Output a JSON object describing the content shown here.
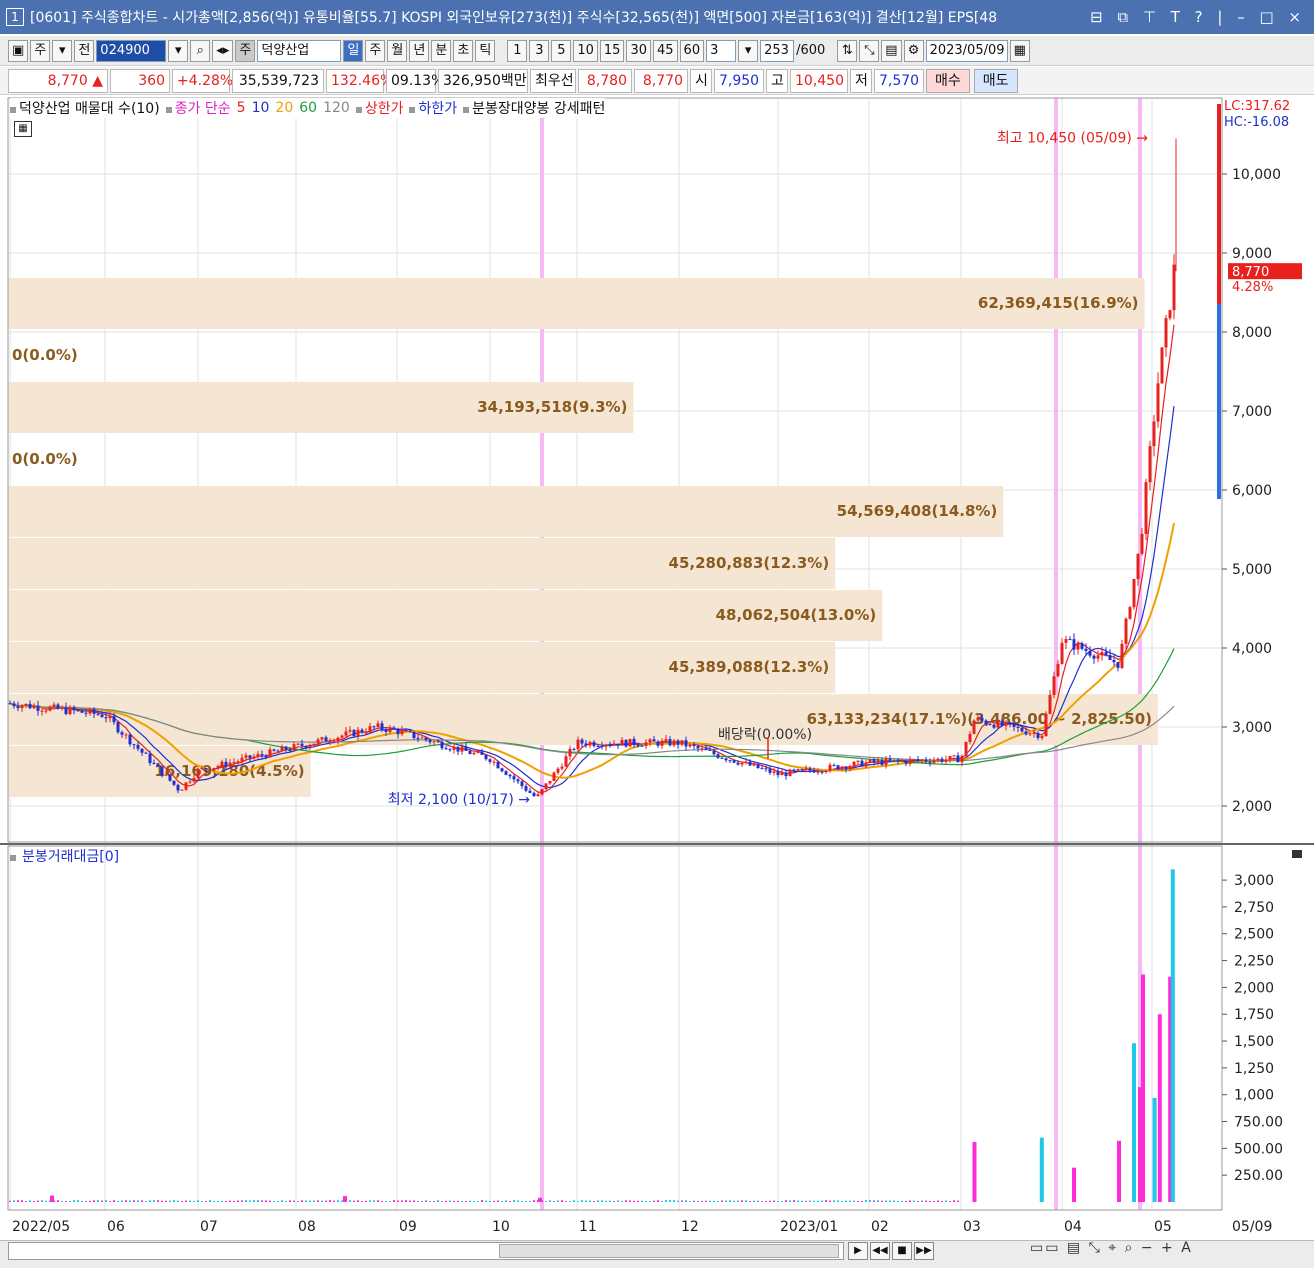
{
  "window": {
    "number": "1",
    "title": "[0601] 주식종합차트 - 시가총액[2,856(억)] 유통비율[55.7] KOSPI 외국인보유[273(천)] 주식수[32,565(천)] 액면[500] 자본금[163(억)] 결산[12월] EPS[48",
    "controls": "⊟ ⧉ ⊤ T ? | – □ ×"
  },
  "toolbar": {
    "market": "주",
    "all": "전",
    "code": "024900",
    "stock_badge": "주",
    "stock_name": "덕양산업",
    "periods": [
      "일",
      "주",
      "월",
      "년",
      "분",
      "초",
      "틱"
    ],
    "selected_period": "일",
    "intervals": [
      "1",
      "3",
      "5",
      "10",
      "15",
      "30",
      "45",
      "60"
    ],
    "interval_value": "3",
    "count": "253",
    "count_total": "/600",
    "date": "2023/05/09"
  },
  "quote": {
    "price": "8,770",
    "arrow": "▲",
    "change": "360",
    "change_pct": "+4.28%",
    "volume": "35,539,723",
    "vol_ratio": "132.46%",
    "turnover": "09.13%",
    "amount": "326,950백만",
    "best_label": "최우선",
    "best_ask": "8,780",
    "best_bid": "8,770",
    "open_label": "시",
    "open": "7,950",
    "high_label": "고",
    "high": "10,450",
    "low_label": "저",
    "low": "7,570",
    "buy": "매수",
    "sell": "매도"
  },
  "legend": {
    "series_name": "덕양산업 매물대 수(10)",
    "ma_label": "종가 단순",
    "ma_periods": [
      "5",
      "10",
      "20",
      "60",
      "120"
    ],
    "upper": "상한가",
    "lower": "하한가",
    "pattern": "분봉장대양봉 강세패턴"
  },
  "price_axis": {
    "labels": [
      "10,000",
      "9,000",
      "8,000",
      "7,000",
      "6,000",
      "5,000",
      "4,000",
      "3,000",
      "2,000"
    ],
    "lc": "LC:317.62",
    "hc": "HC:-16.08",
    "current": "8,770",
    "current_pct": "4.28%"
  },
  "volume_profile": [
    {
      "label": "62,369,415(16.9%)"
    },
    {
      "label": "0(0.0%)"
    },
    {
      "label": "34,193,518(9.3%)"
    },
    {
      "label": "0(0.0%)"
    },
    {
      "label": "54,569,408(14.8%)"
    },
    {
      "label": "45,280,883(12.3%)"
    },
    {
      "label": "48,062,504(13.0%)"
    },
    {
      "label": "45,389,088(12.3%)"
    },
    {
      "label": "63,133,234(17.1%)(3,486.00 ~ 2,825.50)"
    },
    {
      "label": "16,169,180(4.5%)"
    }
  ],
  "annotations": {
    "high": "최고 10,450 (05/09)",
    "low": "최저 2,100 (10/17)",
    "dividend": "배당락(0.00%)"
  },
  "volume_panel": {
    "title": "분봉거래대금[0]",
    "axis": [
      "3,000",
      "2,750",
      "2,500",
      "2,250",
      "2,000",
      "1,750",
      "1,500",
      "1,250",
      "1,000",
      "750.00",
      "500.00",
      "250.00"
    ]
  },
  "x_axis": {
    "labels": [
      "2022/05",
      "06",
      "07",
      "08",
      "09",
      "10",
      "11",
      "12",
      "2023/01",
      "02",
      "03",
      "04",
      "05"
    ],
    "current": "05/09"
  },
  "colors": {
    "up": "#e8201e",
    "down": "#1f2fd0",
    "ma5": "#e8201e",
    "ma10": "#1f2fd0",
    "ma20": "#f0a000",
    "ma60": "#1e9e3a",
    "ma120": "#888888",
    "profile": "#f5e6d3",
    "profile_text": "#8a5a1e",
    "event": "#f6b9f3",
    "vol_up": "#ff2ad9",
    "vol_down": "#1ec8e8"
  },
  "chart_data": {
    "type": "candlestick",
    "title": "덕양산업 일봉",
    "x_range": [
      "2022/05",
      "2023/05/09"
    ],
    "ylim": [
      1800,
      10800
    ],
    "key_points": [
      {
        "date": "2022/05",
        "close": 3300
      },
      {
        "date": "2022/06",
        "close": 3150
      },
      {
        "date": "2022/06/25",
        "close": 2200
      },
      {
        "date": "2022/07",
        "close": 2450
      },
      {
        "date": "2022/08",
        "close": 2750
      },
      {
        "date": "2022/08/25",
        "close": 3000
      },
      {
        "date": "2022/09",
        "close": 2950
      },
      {
        "date": "2022/10",
        "close": 2600
      },
      {
        "date": "2022/10/17",
        "close": 2100
      },
      {
        "date": "2022/11",
        "close": 2800
      },
      {
        "date": "2022/12",
        "close": 2800
      },
      {
        "date": "2023/01",
        "close": 2400
      },
      {
        "date": "2023/02",
        "close": 2550
      },
      {
        "date": "2023/03",
        "close": 2600
      },
      {
        "date": "2023/03/05",
        "close": 3100
      },
      {
        "date": "2023/03/25",
        "close": 2900
      },
      {
        "date": "2023/04",
        "close": 4100
      },
      {
        "date": "2023/04/20",
        "close": 3800
      },
      {
        "date": "2023/04/27",
        "close": 5300
      },
      {
        "date": "2023/05/03",
        "close": 7300
      },
      {
        "date": "2023/05/08",
        "close": 8410
      },
      {
        "date": "2023/05/09",
        "close": 8770,
        "high": 10450
      }
    ],
    "volume_amount": [
      {
        "date": "2023/03/05",
        "value": 560
      },
      {
        "date": "2023/03/25",
        "value": 600
      },
      {
        "date": "2023/04/05",
        "value": 320
      },
      {
        "date": "2023/04/20",
        "value": 570
      },
      {
        "date": "2023/04/25",
        "value": 1480
      },
      {
        "date": "2023/04/27",
        "value": 1070
      },
      {
        "date": "2023/04/28",
        "value": 2120
      },
      {
        "date": "2023/05/02",
        "value": 970
      },
      {
        "date": "2023/05/04",
        "value": 1750
      },
      {
        "date": "2023/05/08",
        "value": 2100
      },
      {
        "date": "2023/05/09",
        "value": 3100
      }
    ]
  }
}
